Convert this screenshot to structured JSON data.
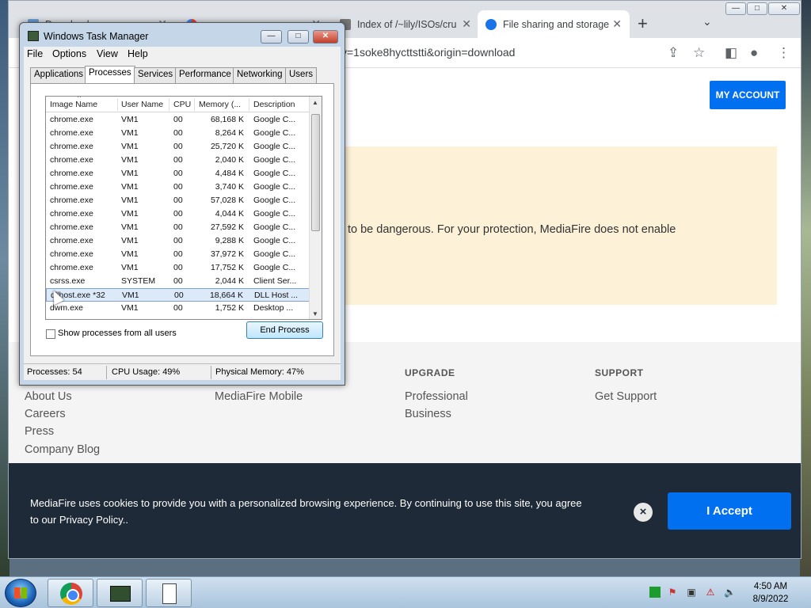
{
  "chrome": {
    "tabs": [
      {
        "label": "Download",
        "active": false
      },
      {
        "label": "",
        "active": false
      },
      {
        "label": "Index of /~lily/ISOs/cru",
        "active": false
      },
      {
        "label": "File sharing and storage",
        "active": true
      }
    ],
    "new_tab": "+",
    "url": "y=1soke8hycttstti&origin=download",
    "window_controls": {
      "minimize": "—",
      "maximize": "□",
      "close": "✕"
    }
  },
  "page": {
    "my_account": "MY ACCOUNT",
    "warning_text": "to be dangerous. For your protection, MediaFire does not enable",
    "footer": {
      "col1_links": [
        "About Us",
        "Careers",
        "Press",
        "Company Blog"
      ],
      "col2_links": [
        "MediaFire Mobile"
      ],
      "upgrade": {
        "title": "UPGRADE",
        "links": [
          "Professional",
          "Business"
        ]
      },
      "support": {
        "title": "SUPPORT",
        "links": [
          "Get Support"
        ]
      }
    },
    "cookie": {
      "text": "MediaFire uses cookies to provide you with a personalized browsing experience. By continuing to use this site, you agree to our Privacy Policy..",
      "accept": "I Accept",
      "close": "×"
    }
  },
  "task_manager": {
    "title": "Windows Task Manager",
    "controls": {
      "minimize": "—",
      "maximize": "□",
      "close": "✕"
    },
    "menu": [
      "File",
      "Options",
      "View",
      "Help"
    ],
    "tabs": [
      "Applications",
      "Processes",
      "Services",
      "Performance",
      "Networking",
      "Users"
    ],
    "active_tab": "Processes",
    "columns": [
      "Image Name",
      "User Name",
      "CPU",
      "Memory (...",
      "Description"
    ],
    "rows": [
      [
        "chrome.exe",
        "VM1",
        "00",
        "68,168 K",
        "Google C..."
      ],
      [
        "chrome.exe",
        "VM1",
        "00",
        "8,264 K",
        "Google C..."
      ],
      [
        "chrome.exe",
        "VM1",
        "00",
        "25,720 K",
        "Google C..."
      ],
      [
        "chrome.exe",
        "VM1",
        "00",
        "2,040 K",
        "Google C..."
      ],
      [
        "chrome.exe",
        "VM1",
        "00",
        "4,484 K",
        "Google C..."
      ],
      [
        "chrome.exe",
        "VM1",
        "00",
        "3,740 K",
        "Google C..."
      ],
      [
        "chrome.exe",
        "VM1",
        "00",
        "57,028 K",
        "Google C..."
      ],
      [
        "chrome.exe",
        "VM1",
        "00",
        "4,044 K",
        "Google C..."
      ],
      [
        "chrome.exe",
        "VM1",
        "00",
        "27,592 K",
        "Google C..."
      ],
      [
        "chrome.exe",
        "VM1",
        "00",
        "9,288 K",
        "Google C..."
      ],
      [
        "chrome.exe",
        "VM1",
        "00",
        "37,972 K",
        "Google C..."
      ],
      [
        "chrome.exe",
        "VM1",
        "00",
        "17,752 K",
        "Google C..."
      ],
      [
        "csrss.exe",
        "SYSTEM",
        "00",
        "2,044 K",
        "Client Ser..."
      ],
      [
        "dllhost.exe *32",
        "VM1",
        "00",
        "18,664 K",
        "DLL Host ..."
      ],
      [
        "dwm.exe",
        "VM1",
        "00",
        "1,752 K",
        "Desktop ..."
      ]
    ],
    "selected_row": 13,
    "show_all_label": "Show processes from all users",
    "end_process": "End Process",
    "status": {
      "processes": "Processes: 54",
      "cpu": "CPU Usage: 49%",
      "memory": "Physical Memory: 47%"
    }
  },
  "taskbar": {
    "time": "4:50 AM",
    "date": "8/9/2022"
  }
}
